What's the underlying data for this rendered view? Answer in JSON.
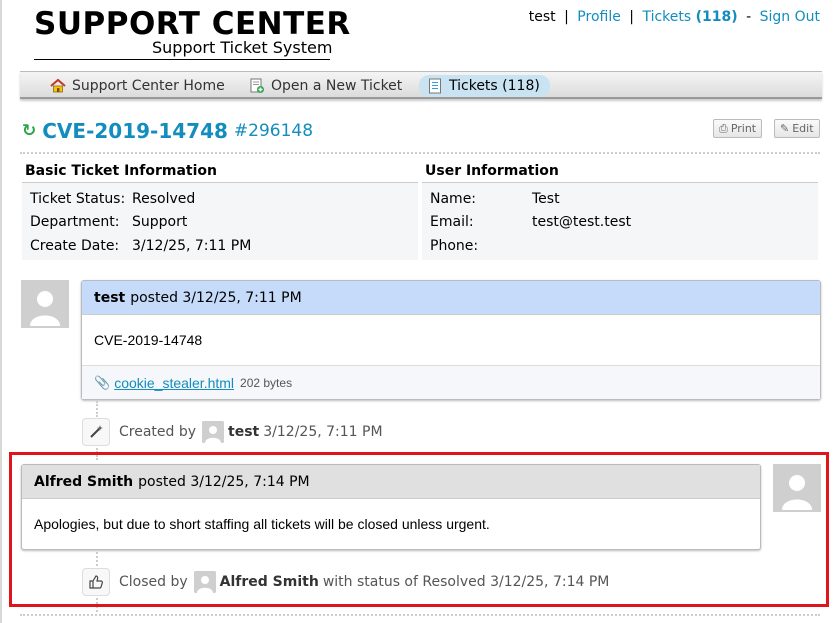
{
  "header": {
    "title": "SUPPORT CENTER",
    "subtitle": "Support Ticket System"
  },
  "userbar": {
    "username": "test",
    "sep1": "|",
    "profile": "Profile",
    "sep2": "|",
    "tickets_label": "Tickets",
    "tickets_count": "(118)",
    "sep3": "-",
    "signout": "Sign Out"
  },
  "nav": {
    "items": [
      {
        "label": "Support Center Home",
        "icon": "home-icon"
      },
      {
        "label": "Open a New Ticket",
        "icon": "new-ticket-icon"
      },
      {
        "label": "Tickets (118)",
        "icon": "tickets-icon",
        "active": true
      }
    ]
  },
  "ticket": {
    "subject": "CVE-2019-14748",
    "number": "#296148",
    "print_label": "Print",
    "edit_label": "Edit"
  },
  "basic_info": {
    "heading": "Basic Ticket Information",
    "rows": [
      {
        "key": "Ticket Status:",
        "value": "Resolved"
      },
      {
        "key": "Department:",
        "value": "Support"
      },
      {
        "key": "Create Date:",
        "value": "3/12/25, 7:11 PM"
      }
    ]
  },
  "user_info": {
    "heading": "User Information",
    "rows": [
      {
        "key": "Name:",
        "value": "Test"
      },
      {
        "key": "Email:",
        "value": "test@test.test"
      },
      {
        "key": "Phone:",
        "value": ""
      }
    ]
  },
  "thread": {
    "entry1": {
      "author": "test",
      "posted": "posted 3/12/25, 7:11 PM",
      "body": "CVE-2019-14748",
      "attachment_name": "cookie_stealer.html",
      "attachment_size": "202 bytes",
      "header_color": "#c5dbf9"
    },
    "event1": {
      "prefix": "Created by",
      "user": "test",
      "time": "3/12/25, 7:11 PM"
    },
    "entry2": {
      "author": "Alfred Smith",
      "posted": "posted 3/12/25, 7:14 PM",
      "body": "Apologies, but due to short staffing all tickets will be closed unless urgent.",
      "header_color": "#e0e0e0"
    },
    "event2": {
      "prefix": "Closed by",
      "user": "Alfred Smith",
      "suffix": "with status of Resolved 3/12/25, 7:14 PM"
    }
  },
  "colors": {
    "link": "#128dbe",
    "highlight_border": "#e0141b",
    "refresh": "#2aa64a"
  }
}
